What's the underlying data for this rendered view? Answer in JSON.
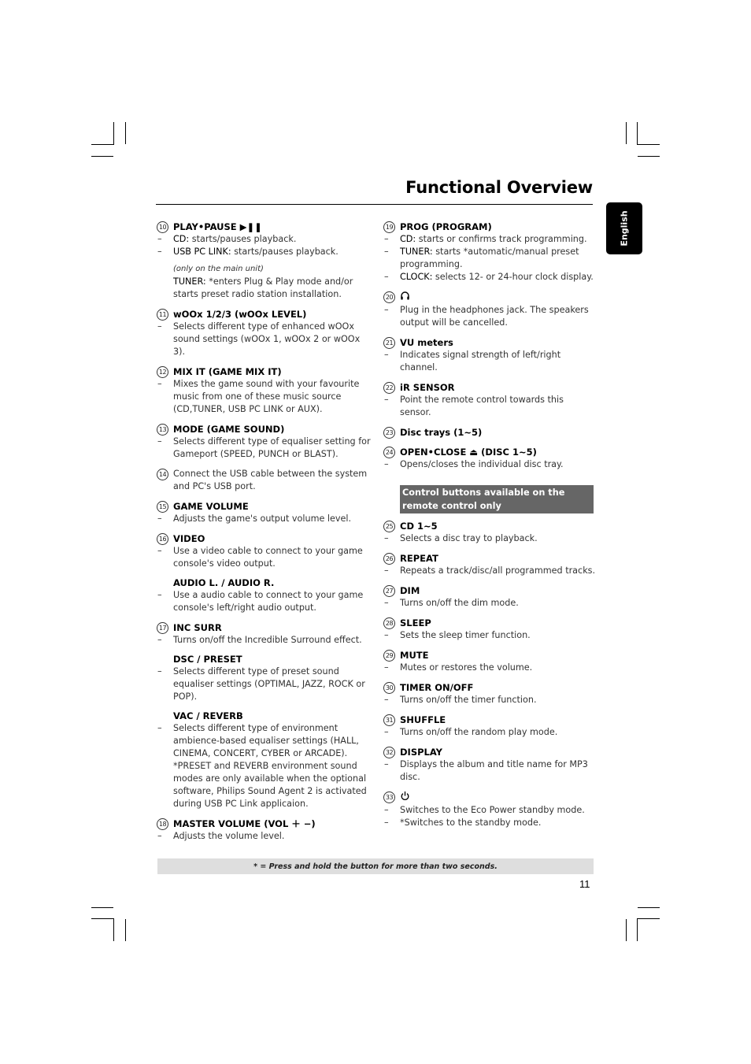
{
  "header": {
    "title": "Functional Overview",
    "language_tab": "English"
  },
  "left_column": [
    {
      "num": "10",
      "title": "PLAY•PAUSE ▶❚❚",
      "lines": [
        {
          "type": "dash",
          "key": "CD:",
          "text": " starts/pauses playback."
        },
        {
          "type": "dash",
          "key": "USB PC LINK:",
          "text": " starts/pauses playback."
        }
      ],
      "note": "(only on the main unit)",
      "extra": {
        "key": "TUNER:",
        "text": " *enters Plug & Play mode and/or starts preset radio station installation."
      }
    },
    {
      "num": "11",
      "title": "wOOx 1/2/3 (wOOx LEVEL)",
      "lines": [
        {
          "type": "dash",
          "text": "Selects different type of enhanced wOOx sound settings (wOOx 1, wOOx 2 or wOOx 3)."
        }
      ]
    },
    {
      "num": "12",
      "title": "MIX IT (GAME MIX IT)",
      "lines": [
        {
          "type": "dash",
          "text": "Mixes the game sound with your favourite music from one of these music source (CD,TUNER, USB PC LINK or AUX)."
        }
      ]
    },
    {
      "num": "13",
      "title": "MODE (GAME SOUND)",
      "lines": [
        {
          "type": "dash",
          "text": "Selects different type of equaliser setting for Gameport (SPEED, PUNCH or BLAST)."
        }
      ]
    },
    {
      "num": "14",
      "title_plain": "Connect the USB cable between the system and PC's USB port."
    },
    {
      "num": "15",
      "title": "GAME VOLUME",
      "lines": [
        {
          "type": "dash",
          "text": "Adjusts the game's output volume level."
        }
      ]
    },
    {
      "num": "16",
      "title": "VIDEO",
      "lines": [
        {
          "type": "dash",
          "text": "Use a video cable to connect to your game console's video output."
        }
      ],
      "subsections": [
        {
          "title": "AUDIO L. / AUDIO R.",
          "lines": [
            {
              "type": "dash",
              "text": "Use a audio cable to connect to your game console's left/right audio output."
            }
          ]
        }
      ]
    },
    {
      "num": "17",
      "title": "INC SURR",
      "lines": [
        {
          "type": "dash",
          "text": "Turns on/off the Incredible Surround effect."
        }
      ],
      "subsections": [
        {
          "title": "DSC / PRESET",
          "lines": [
            {
              "type": "dash",
              "text": "Selects different type of preset sound equaliser settings (OPTIMAL, JAZZ, ROCK or POP)."
            }
          ]
        },
        {
          "title": "VAC / REVERB",
          "lines": [
            {
              "type": "dash",
              "text": "Selects different type of environment ambience-based equaliser settings (HALL, CINEMA, CONCERT, CYBER or ARCADE)."
            },
            {
              "type": "plain",
              "text": "*PRESET and REVERB environment sound modes are only available when the optional software, Philips Sound Agent 2 is activated during USB PC Link applicaion."
            }
          ]
        }
      ]
    },
    {
      "num": "18",
      "title": "MASTER VOLUME (VOL ＋ −)",
      "lines": [
        {
          "type": "dash",
          "text": "Adjusts the volume level."
        }
      ]
    }
  ],
  "right_column": [
    {
      "num": "19",
      "title": "PROG (PROGRAM)",
      "lines": [
        {
          "type": "dash",
          "key": "CD:",
          "text": " starts or confirms track programming."
        },
        {
          "type": "dash",
          "key": "TUNER:",
          "text": " starts *automatic/manual preset programming."
        },
        {
          "type": "dash",
          "key": "CLOCK:",
          "text": " selects 12- or 24-hour clock display."
        }
      ]
    },
    {
      "num": "20",
      "icon": "headphones-icon",
      "lines": [
        {
          "type": "dash",
          "text": "Plug in the headphones jack. The speakers output will be cancelled."
        }
      ]
    },
    {
      "num": "21",
      "title": "VU meters",
      "lines": [
        {
          "type": "dash",
          "text": "Indicates signal strength of left/right channel."
        }
      ]
    },
    {
      "num": "22",
      "title": "iR SENSOR",
      "lines": [
        {
          "type": "dash",
          "text": "Point the remote control towards this sensor."
        }
      ]
    },
    {
      "num": "23",
      "title": "Disc trays (1~5)",
      "lines": []
    },
    {
      "num": "24",
      "title": "OPEN•CLOSE ⏏ (DISC 1~5)",
      "lines": [
        {
          "type": "dash",
          "text": "Opens/closes the individual disc tray."
        }
      ]
    }
  ],
  "remote_banner": "Control buttons available on the remote control only",
  "remote_column": [
    {
      "num": "25",
      "title": "CD 1~5",
      "lines": [
        {
          "type": "dash",
          "text": "Selects a disc tray to playback."
        }
      ]
    },
    {
      "num": "26",
      "title": "REPEAT",
      "lines": [
        {
          "type": "dash",
          "text": "Repeats a track/disc/all programmed tracks."
        }
      ]
    },
    {
      "num": "27",
      "title": "DIM",
      "lines": [
        {
          "type": "dash",
          "text": "Turns on/off the dim mode."
        }
      ]
    },
    {
      "num": "28",
      "title": "SLEEP",
      "lines": [
        {
          "type": "dash",
          "text": "Sets the sleep timer function."
        }
      ]
    },
    {
      "num": "29",
      "title": "MUTE",
      "lines": [
        {
          "type": "dash",
          "text": "Mutes or restores the volume."
        }
      ]
    },
    {
      "num": "30",
      "title": "TIMER ON/OFF",
      "lines": [
        {
          "type": "dash",
          "text": "Turns on/off the timer function."
        }
      ]
    },
    {
      "num": "31",
      "title": "SHUFFLE",
      "lines": [
        {
          "type": "dash",
          "text": "Turns on/off the random play mode."
        }
      ]
    },
    {
      "num": "32",
      "title": "DISPLAY",
      "lines": [
        {
          "type": "dash",
          "text": "Displays the album and title name for MP3 disc."
        }
      ]
    },
    {
      "num": "33",
      "icon": "power-icon",
      "lines": [
        {
          "type": "dash",
          "text": "Switches to the Eco Power standby mode."
        },
        {
          "type": "dash",
          "text": "*Switches to the standby mode."
        }
      ]
    }
  ],
  "footer": {
    "note": "* = Press and hold the button for more than two seconds.",
    "page_number": "11"
  },
  "dash_char": "–"
}
